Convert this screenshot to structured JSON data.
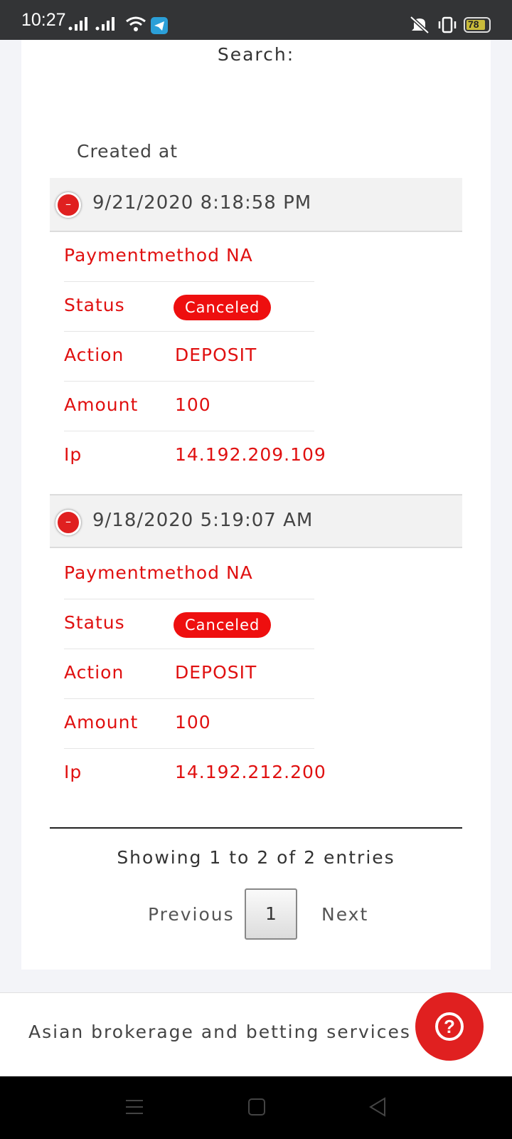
{
  "status_bar": {
    "time": "10:27",
    "battery": "78"
  },
  "table": {
    "search_label": "Search:",
    "column_header": "Created at",
    "records": [
      {
        "created_at": "9/21/2020 8:18:58 PM",
        "paymentmethod_label": "Paymentmethod",
        "paymentmethod_value": "NA",
        "status_label": "Status",
        "status_value": "Canceled",
        "action_label": "Action",
        "action_value": "DEPOSIT",
        "amount_label": "Amount",
        "amount_value": "100",
        "ip_label": "Ip",
        "ip_value": "14.192.209.109"
      },
      {
        "created_at": "9/18/2020 5:19:07 AM",
        "paymentmethod_label": "Paymentmethod",
        "paymentmethod_value": "NA",
        "status_label": "Status",
        "status_value": "Canceled",
        "action_label": "Action",
        "action_value": "DEPOSIT",
        "amount_label": "Amount",
        "amount_value": "100",
        "ip_label": "Ip",
        "ip_value": "14.192.212.200"
      }
    ],
    "info": "Showing 1 to 2 of 2 entries",
    "pagination": {
      "previous": "Previous",
      "current_page": "1",
      "next": "Next"
    }
  },
  "footer": {
    "tagline": "Asian brokerage and betting services",
    "help_icon": "question-mark-icon"
  },
  "colors": {
    "accent_red": "#e01010",
    "badge_red": "#ee0f0f",
    "help_red": "#e02020"
  }
}
